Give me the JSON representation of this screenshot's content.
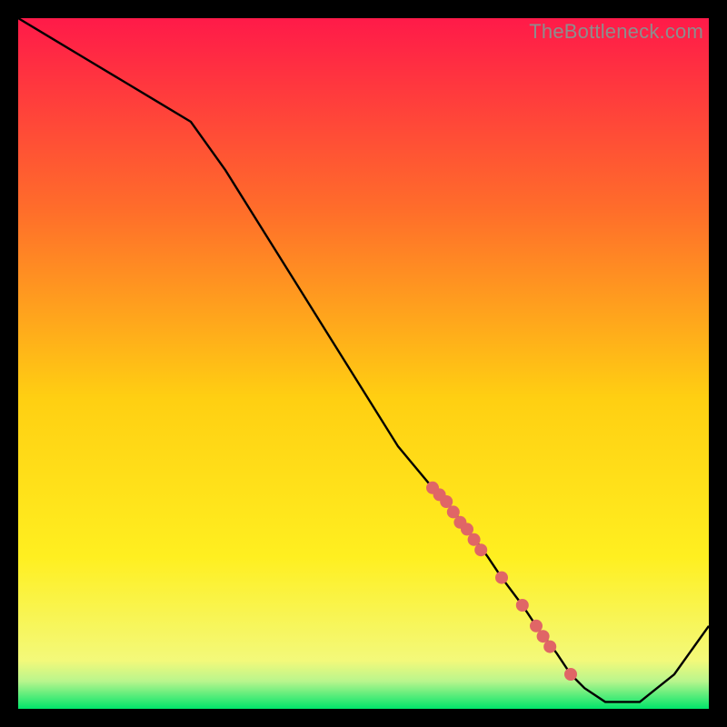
{
  "watermark": "TheBottleneck.com",
  "chart_data": {
    "type": "line",
    "title": "",
    "xlabel": "",
    "ylabel": "",
    "xlim": [
      0,
      100
    ],
    "ylim": [
      0,
      100
    ],
    "grid": false,
    "legend": false,
    "background_gradient": {
      "top_color": "#ff1a49",
      "mid_color": "#ffe012",
      "bottom_band_color": "#00e56a",
      "bottom_band_fraction": 0.04
    },
    "series": [
      {
        "name": "curve",
        "color": "#000000",
        "x": [
          0,
          5,
          10,
          15,
          20,
          25,
          30,
          35,
          40,
          45,
          50,
          55,
          60,
          62,
          65,
          68,
          70,
          73,
          75,
          78,
          80,
          82,
          85,
          90,
          95,
          100
        ],
        "y": [
          100,
          97,
          94,
          91,
          88,
          85,
          78,
          70,
          62,
          54,
          46,
          38,
          32,
          30,
          26,
          22,
          19,
          15,
          12,
          8,
          5,
          3,
          1,
          1,
          5,
          12
        ]
      }
    ],
    "highlight_points": {
      "name": "dots",
      "color": "#e06666",
      "radius": 7,
      "points": [
        {
          "x": 60,
          "y": 32
        },
        {
          "x": 61,
          "y": 31
        },
        {
          "x": 62,
          "y": 30
        },
        {
          "x": 63,
          "y": 28.5
        },
        {
          "x": 64,
          "y": 27
        },
        {
          "x": 65,
          "y": 26
        },
        {
          "x": 66,
          "y": 24.5
        },
        {
          "x": 67,
          "y": 23
        },
        {
          "x": 70,
          "y": 19
        },
        {
          "x": 73,
          "y": 15
        },
        {
          "x": 75,
          "y": 12
        },
        {
          "x": 76,
          "y": 10.5
        },
        {
          "x": 77,
          "y": 9
        },
        {
          "x": 80,
          "y": 5
        }
      ]
    }
  }
}
